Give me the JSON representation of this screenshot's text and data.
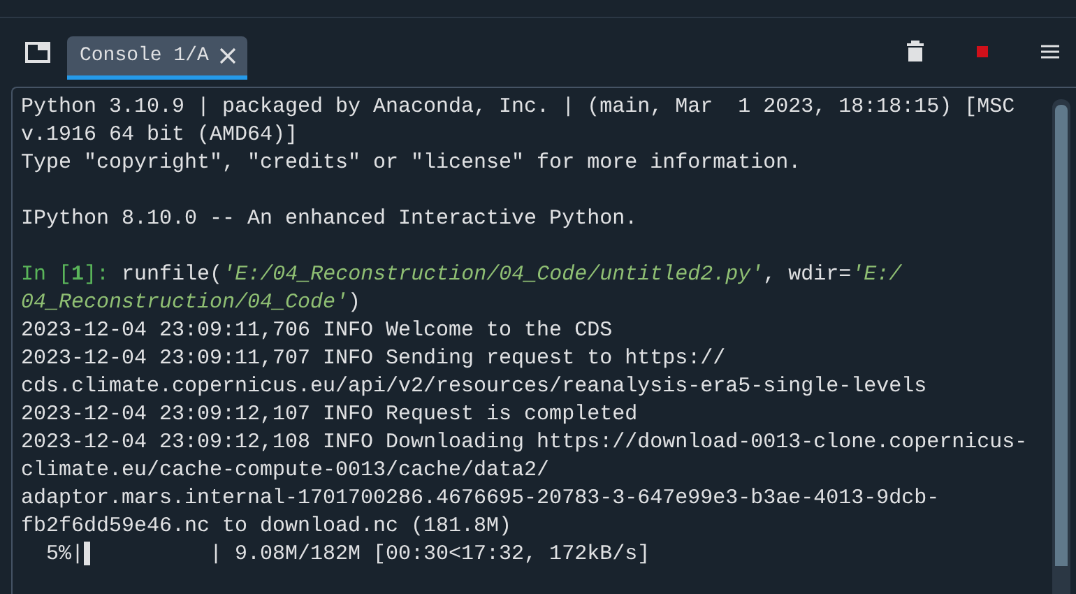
{
  "tabs": [
    {
      "label": "Console 1/A",
      "selected": true
    }
  ],
  "console": {
    "lines": [
      {
        "segments": [
          {
            "kind": "plain",
            "text": "Python 3.10.9 | packaged by Anaconda, Inc. | (main, Mar  1 2023, 18:18:15) [MSC"
          }
        ]
      },
      {
        "segments": [
          {
            "kind": "plain",
            "text": "v.1916 64 bit (AMD64)]"
          }
        ]
      },
      {
        "segments": [
          {
            "kind": "plain",
            "text": "Type \"copyright\", \"credits\" or \"license\" for more information."
          }
        ]
      },
      {
        "kind": "blank"
      },
      {
        "segments": [
          {
            "kind": "plain",
            "text": "IPython 8.10.0 -- An enhanced Interactive Python."
          }
        ]
      },
      {
        "kind": "blank"
      },
      {
        "segments": [
          {
            "kind": "prompt",
            "text": "In ["
          },
          {
            "kind": "prompt-number",
            "text": "1"
          },
          {
            "kind": "prompt",
            "text": "]: "
          },
          {
            "kind": "plain",
            "text": "runfile("
          },
          {
            "kind": "string",
            "text": "'E:/04_Reconstruction/04_Code/untitled2.py'"
          },
          {
            "kind": "plain",
            "text": ", wdir="
          },
          {
            "kind": "string",
            "text": "'E:/"
          }
        ]
      },
      {
        "segments": [
          {
            "kind": "string",
            "text": "04_Reconstruction/04_Code'"
          },
          {
            "kind": "plain",
            "text": ")"
          }
        ]
      },
      {
        "segments": [
          {
            "kind": "plain",
            "text": "2023-12-04 23:09:11,706 INFO Welcome to the CDS"
          }
        ]
      },
      {
        "segments": [
          {
            "kind": "plain",
            "text": "2023-12-04 23:09:11,707 INFO Sending request to https://"
          }
        ]
      },
      {
        "segments": [
          {
            "kind": "plain",
            "text": "cds.climate.copernicus.eu/api/v2/resources/reanalysis-era5-single-levels"
          }
        ]
      },
      {
        "segments": [
          {
            "kind": "plain",
            "text": "2023-12-04 23:09:12,107 INFO Request is completed"
          }
        ]
      },
      {
        "segments": [
          {
            "kind": "plain",
            "text": "2023-12-04 23:09:12,108 INFO Downloading https://download-0013-clone.copernicus-"
          }
        ]
      },
      {
        "segments": [
          {
            "kind": "plain",
            "text": "climate.eu/cache-compute-0013/cache/data2/"
          }
        ]
      },
      {
        "segments": [
          {
            "kind": "plain",
            "text": "adaptor.mars.internal-1701700286.4676695-20783-3-647e99e3-b3ae-4013-9dcb-"
          }
        ]
      },
      {
        "segments": [
          {
            "kind": "plain",
            "text": "fb2f6dd59e46.nc to download.nc (181.8M)"
          }
        ]
      },
      {
        "segments": [
          {
            "kind": "plain",
            "text": "  5%|▌         | 9.08M/182M [00:30<17:32, 172kB/s]"
          }
        ]
      }
    ]
  }
}
